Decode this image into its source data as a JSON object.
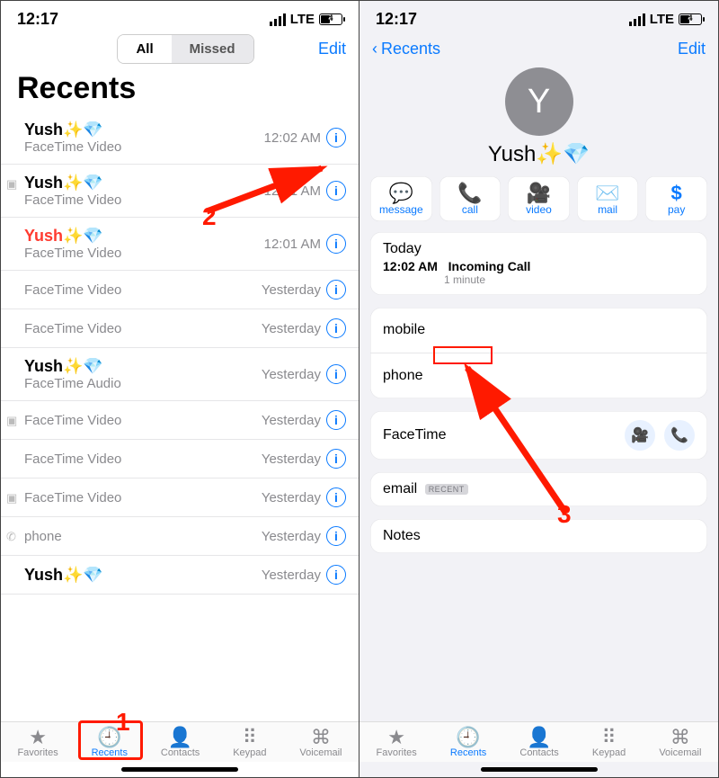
{
  "status": {
    "time": "12:17",
    "carrier": "LTE",
    "battery": "4"
  },
  "left": {
    "segAll": "All",
    "segMissed": "Missed",
    "edit": "Edit",
    "title": "Recents",
    "calls": [
      {
        "name": "Yush✨💎",
        "sub": "FaceTime Video",
        "time": "12:02 AM",
        "missed": false,
        "lead": ""
      },
      {
        "name": "Yush✨💎",
        "sub": "FaceTime Video",
        "time": "12:01 AM",
        "missed": false,
        "lead": "video"
      },
      {
        "name": "Yush✨💎",
        "sub": "FaceTime Video",
        "time": "12:01 AM",
        "missed": true,
        "lead": ""
      },
      {
        "name": "",
        "sub": "FaceTime Video",
        "time": "Yesterday",
        "missed": false,
        "lead": ""
      },
      {
        "name": "",
        "sub": "FaceTime Video",
        "time": "Yesterday",
        "missed": false,
        "lead": ""
      },
      {
        "name": "Yush✨💎",
        "sub": "FaceTime Audio",
        "time": "Yesterday",
        "missed": false,
        "lead": ""
      },
      {
        "name": "",
        "sub": "FaceTime Video",
        "time": "Yesterday",
        "missed": false,
        "lead": "video"
      },
      {
        "name": "",
        "sub": "FaceTime Video",
        "time": "Yesterday",
        "missed": false,
        "lead": ""
      },
      {
        "name": "",
        "sub": "FaceTime Video",
        "time": "Yesterday",
        "missed": false,
        "lead": "video"
      },
      {
        "name": "",
        "sub": "phone",
        "time": "Yesterday",
        "missed": false,
        "lead": "phone"
      },
      {
        "name": "Yush✨💎",
        "sub": "",
        "time": "Yesterday",
        "missed": false,
        "lead": ""
      }
    ],
    "tabs": {
      "favorites": "Favorites",
      "recents": "Recents",
      "contacts": "Contacts",
      "keypad": "Keypad",
      "voicemail": "Voicemail"
    }
  },
  "right": {
    "back": "Recents",
    "edit": "Edit",
    "avatarLetter": "Y",
    "contactName": "Yush✨💎",
    "actions": {
      "message": "message",
      "call": "call",
      "video": "video",
      "mail": "mail",
      "pay": "pay"
    },
    "today": {
      "header": "Today",
      "time": "12:02 AM",
      "type": "Incoming Call",
      "duration": "1 minute"
    },
    "mobile": "mobile",
    "phone": "phone",
    "facetime": "FaceTime",
    "email": "email",
    "emailBadge": "RECENT",
    "notes": "Notes"
  },
  "annotations": {
    "n1": "1",
    "n2": "2",
    "n3": "3"
  }
}
